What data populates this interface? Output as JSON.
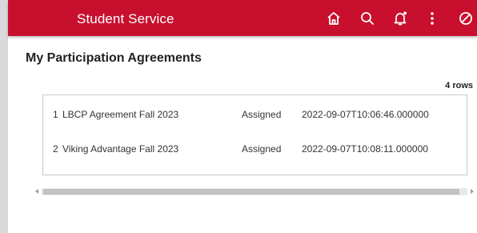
{
  "header": {
    "title": "Student Service",
    "icons": [
      "home-icon",
      "search-icon",
      "notification-bell-icon",
      "more-options-icon",
      "no-entry-icon"
    ],
    "background_color": "#c8102e"
  },
  "page": {
    "title": "My Participation Agreements",
    "row_count": "4 rows"
  },
  "grid": {
    "rows": [
      {
        "num": "1",
        "name": "LBCP Agreement Fall 2023",
        "status": "Assigned",
        "date": "2022-09-07T10:06:46.000000"
      },
      {
        "num": "2",
        "name": "Viking Advantage Fall 2023",
        "status": "Assigned",
        "date": "2022-09-07T10:08:11.000000"
      }
    ]
  }
}
